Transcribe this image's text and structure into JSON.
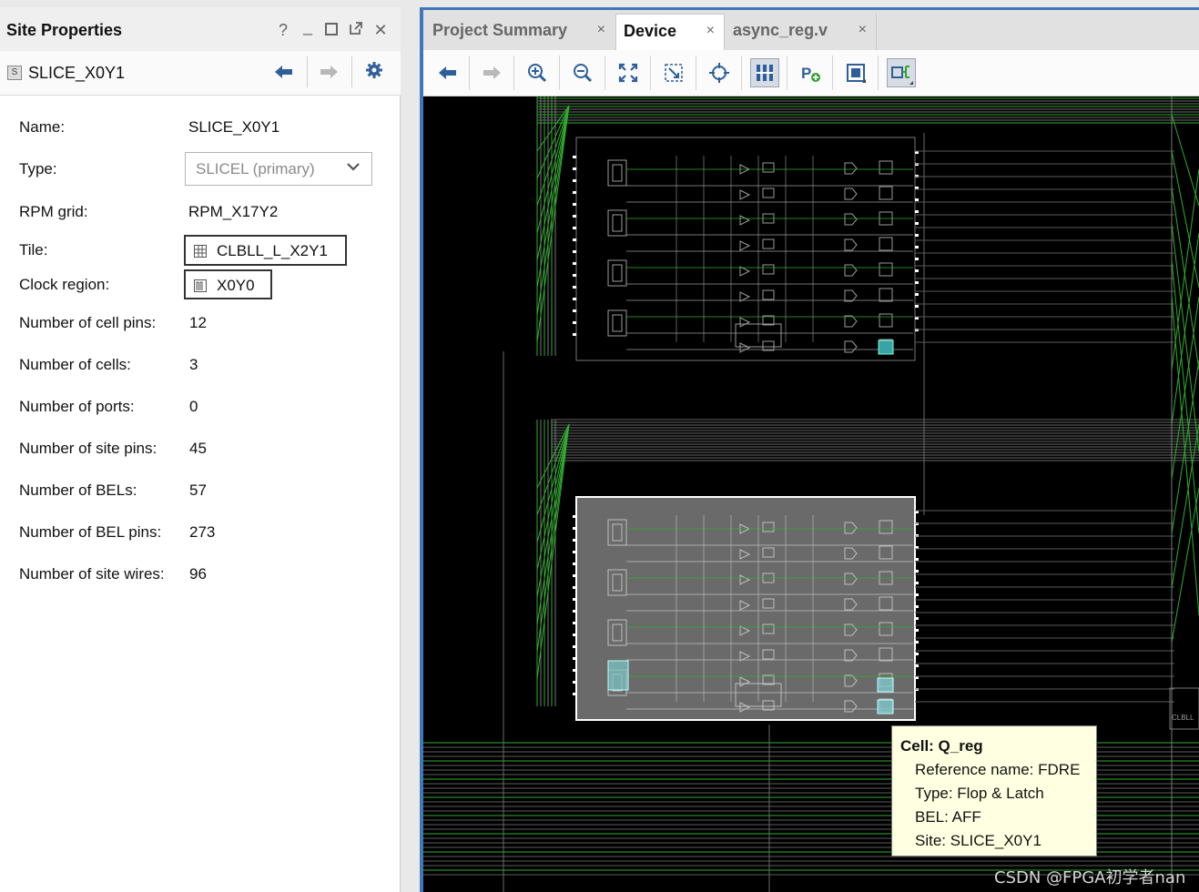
{
  "panel": {
    "title": "Site Properties",
    "buttons": {
      "help": "?",
      "minimize": "_",
      "maximize": "□",
      "float": "⧉",
      "close": "✕"
    },
    "site_name": "SLICE_X0Y1",
    "site_badge": "S"
  },
  "properties": {
    "name_label": "Name:",
    "name_value": "SLICE_X0Y1",
    "type_label": "Type:",
    "type_value": "SLICEL (primary)",
    "rpm_label": "RPM grid:",
    "rpm_value": "RPM_X17Y2",
    "tile_label": "Tile:",
    "tile_value": "CLBLL_L_X2Y1",
    "clock_label": "Clock region:",
    "clock_value": "X0Y0",
    "cell_pins_label": "Number of cell pins:",
    "cell_pins_value": "12",
    "cells_label": "Number of cells:",
    "cells_value": "3",
    "ports_label": "Number of ports:",
    "ports_value": "0",
    "site_pins_label": "Number of site pins:",
    "site_pins_value": "45",
    "bels_label": "Number of BELs:",
    "bels_value": "57",
    "bel_pins_label": "Number of BEL pins:",
    "bel_pins_value": "273",
    "site_wires_label": "Number of site wires:",
    "site_wires_value": "96"
  },
  "tabs": [
    {
      "label": "Project Summary",
      "close": "×"
    },
    {
      "label": "Device",
      "close": "×"
    },
    {
      "label": "async_reg.v",
      "close": "×"
    }
  ],
  "toolbar_icons": [
    "back-icon",
    "forward-icon",
    "zoom-in-icon",
    "zoom-out-icon",
    "fit-icon",
    "zoom-selection-icon",
    "auto-fit-icon",
    "routing-resources-icon",
    "add-pblock-icon",
    "site-view-icon",
    "io-view-icon"
  ],
  "device_view": {
    "corner_label": "CLBLL"
  },
  "tooltip": {
    "title": "Cell: Q_reg",
    "ref": "Reference name: FDRE",
    "type": "Type: Flop & Latch",
    "bel": "BEL: AFF",
    "site": "Site: SLICE_X0Y1"
  },
  "watermark": "CSDN @FPGA初学者nan",
  "colors": {
    "accent": "#3f78b8",
    "net_green": "#2fae2f",
    "selection_cyan": "#7fc8c8"
  }
}
